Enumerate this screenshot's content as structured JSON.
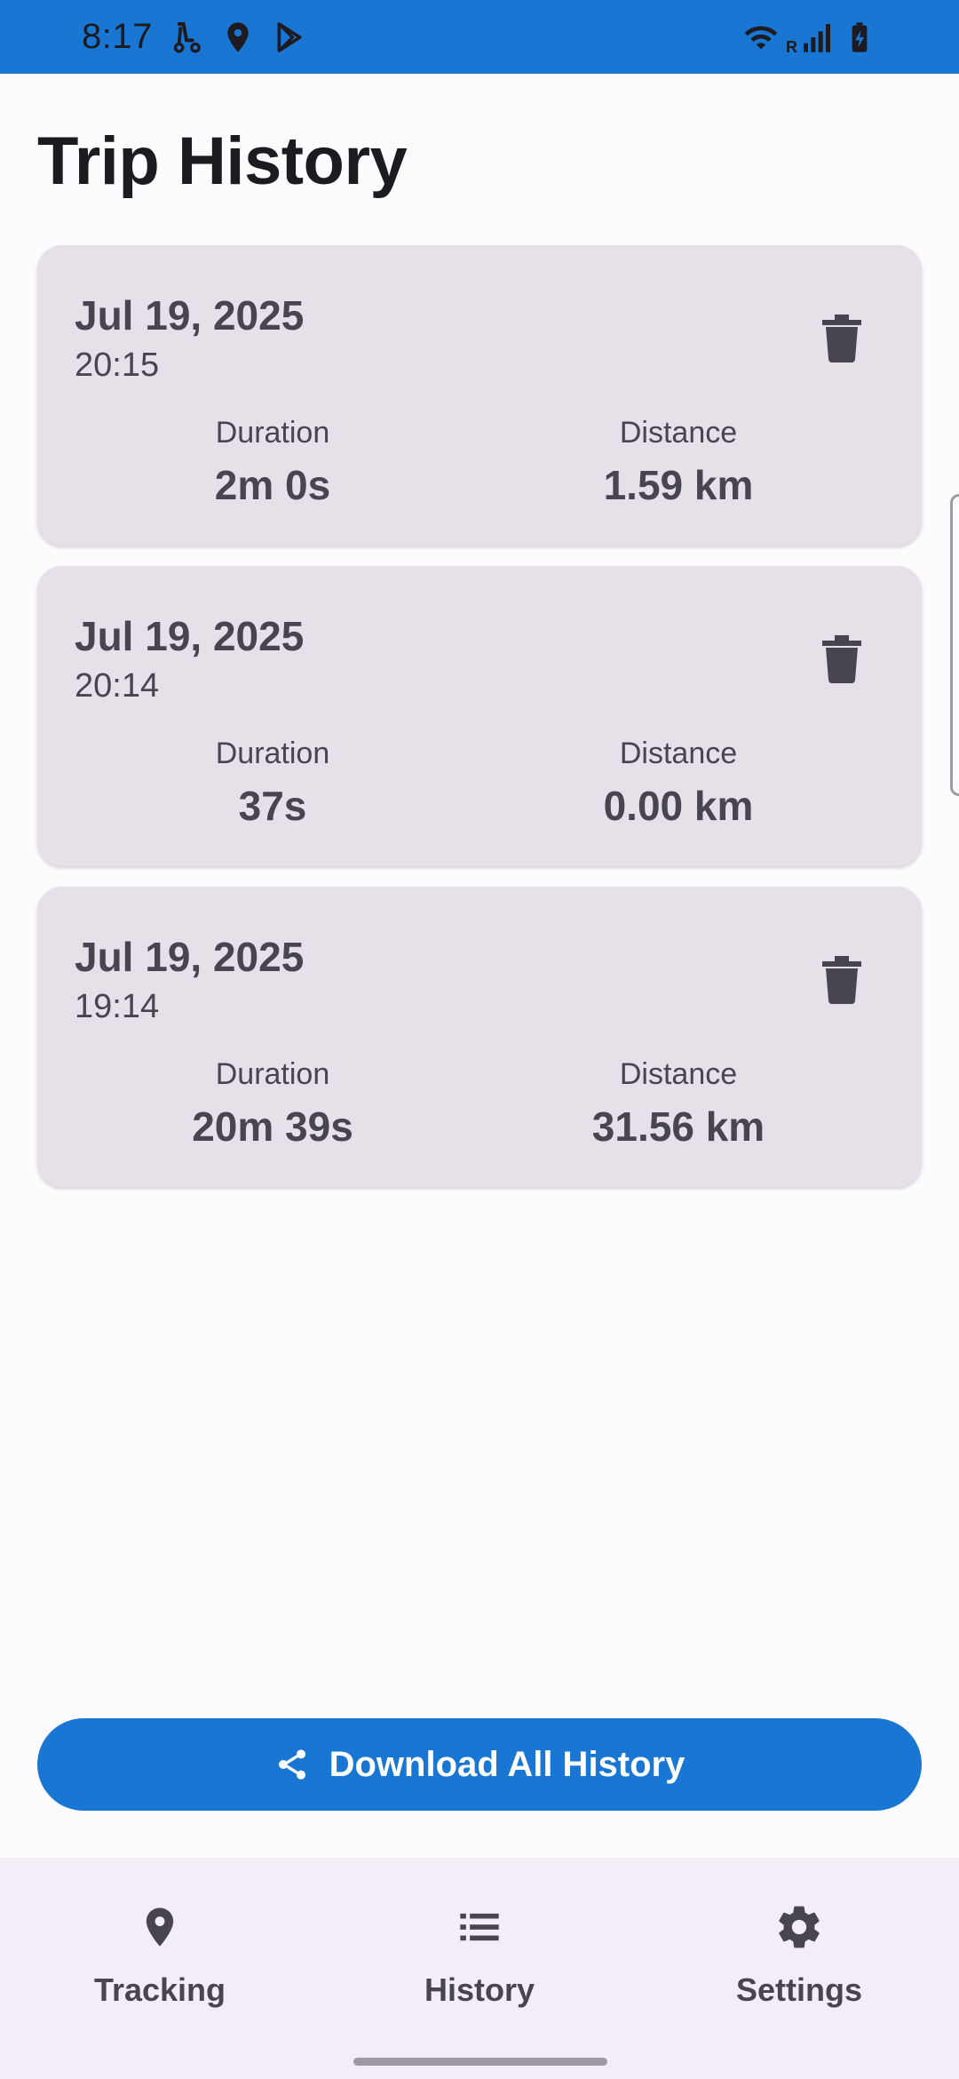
{
  "status_bar": {
    "time": "8:17",
    "left_icons": [
      "scooter-icon",
      "location-icon",
      "play-store-icon"
    ],
    "right_icons": [
      "wifi-icon",
      "signal-icon",
      "battery-charging-icon"
    ],
    "roaming_label": "R"
  },
  "page": {
    "title": "Trip History"
  },
  "trips": [
    {
      "date": "Jul 19, 2025",
      "time": "20:15",
      "duration_label": "Duration",
      "duration": "2m 0s",
      "distance_label": "Distance",
      "distance": "1.59 km"
    },
    {
      "date": "Jul 19, 2025",
      "time": "20:14",
      "duration_label": "Duration",
      "duration": "37s",
      "distance_label": "Distance",
      "distance": "0.00 km"
    },
    {
      "date": "Jul 19, 2025",
      "time": "19:14",
      "duration_label": "Duration",
      "duration": "20m 39s",
      "distance_label": "Distance",
      "distance": "31.56 km"
    }
  ],
  "download_button": {
    "label": "Download All History",
    "icon": "share-icon"
  },
  "bottom_nav": {
    "items": [
      {
        "label": "Tracking",
        "icon": "location-pin-icon"
      },
      {
        "label": "History",
        "icon": "list-icon"
      },
      {
        "label": "Settings",
        "icon": "gear-icon"
      }
    ]
  },
  "colors": {
    "primary": "#1976d2",
    "card_bg": "#e6e0e9",
    "text_secondary": "#49454f",
    "nav_bg": "#f3edf7"
  }
}
